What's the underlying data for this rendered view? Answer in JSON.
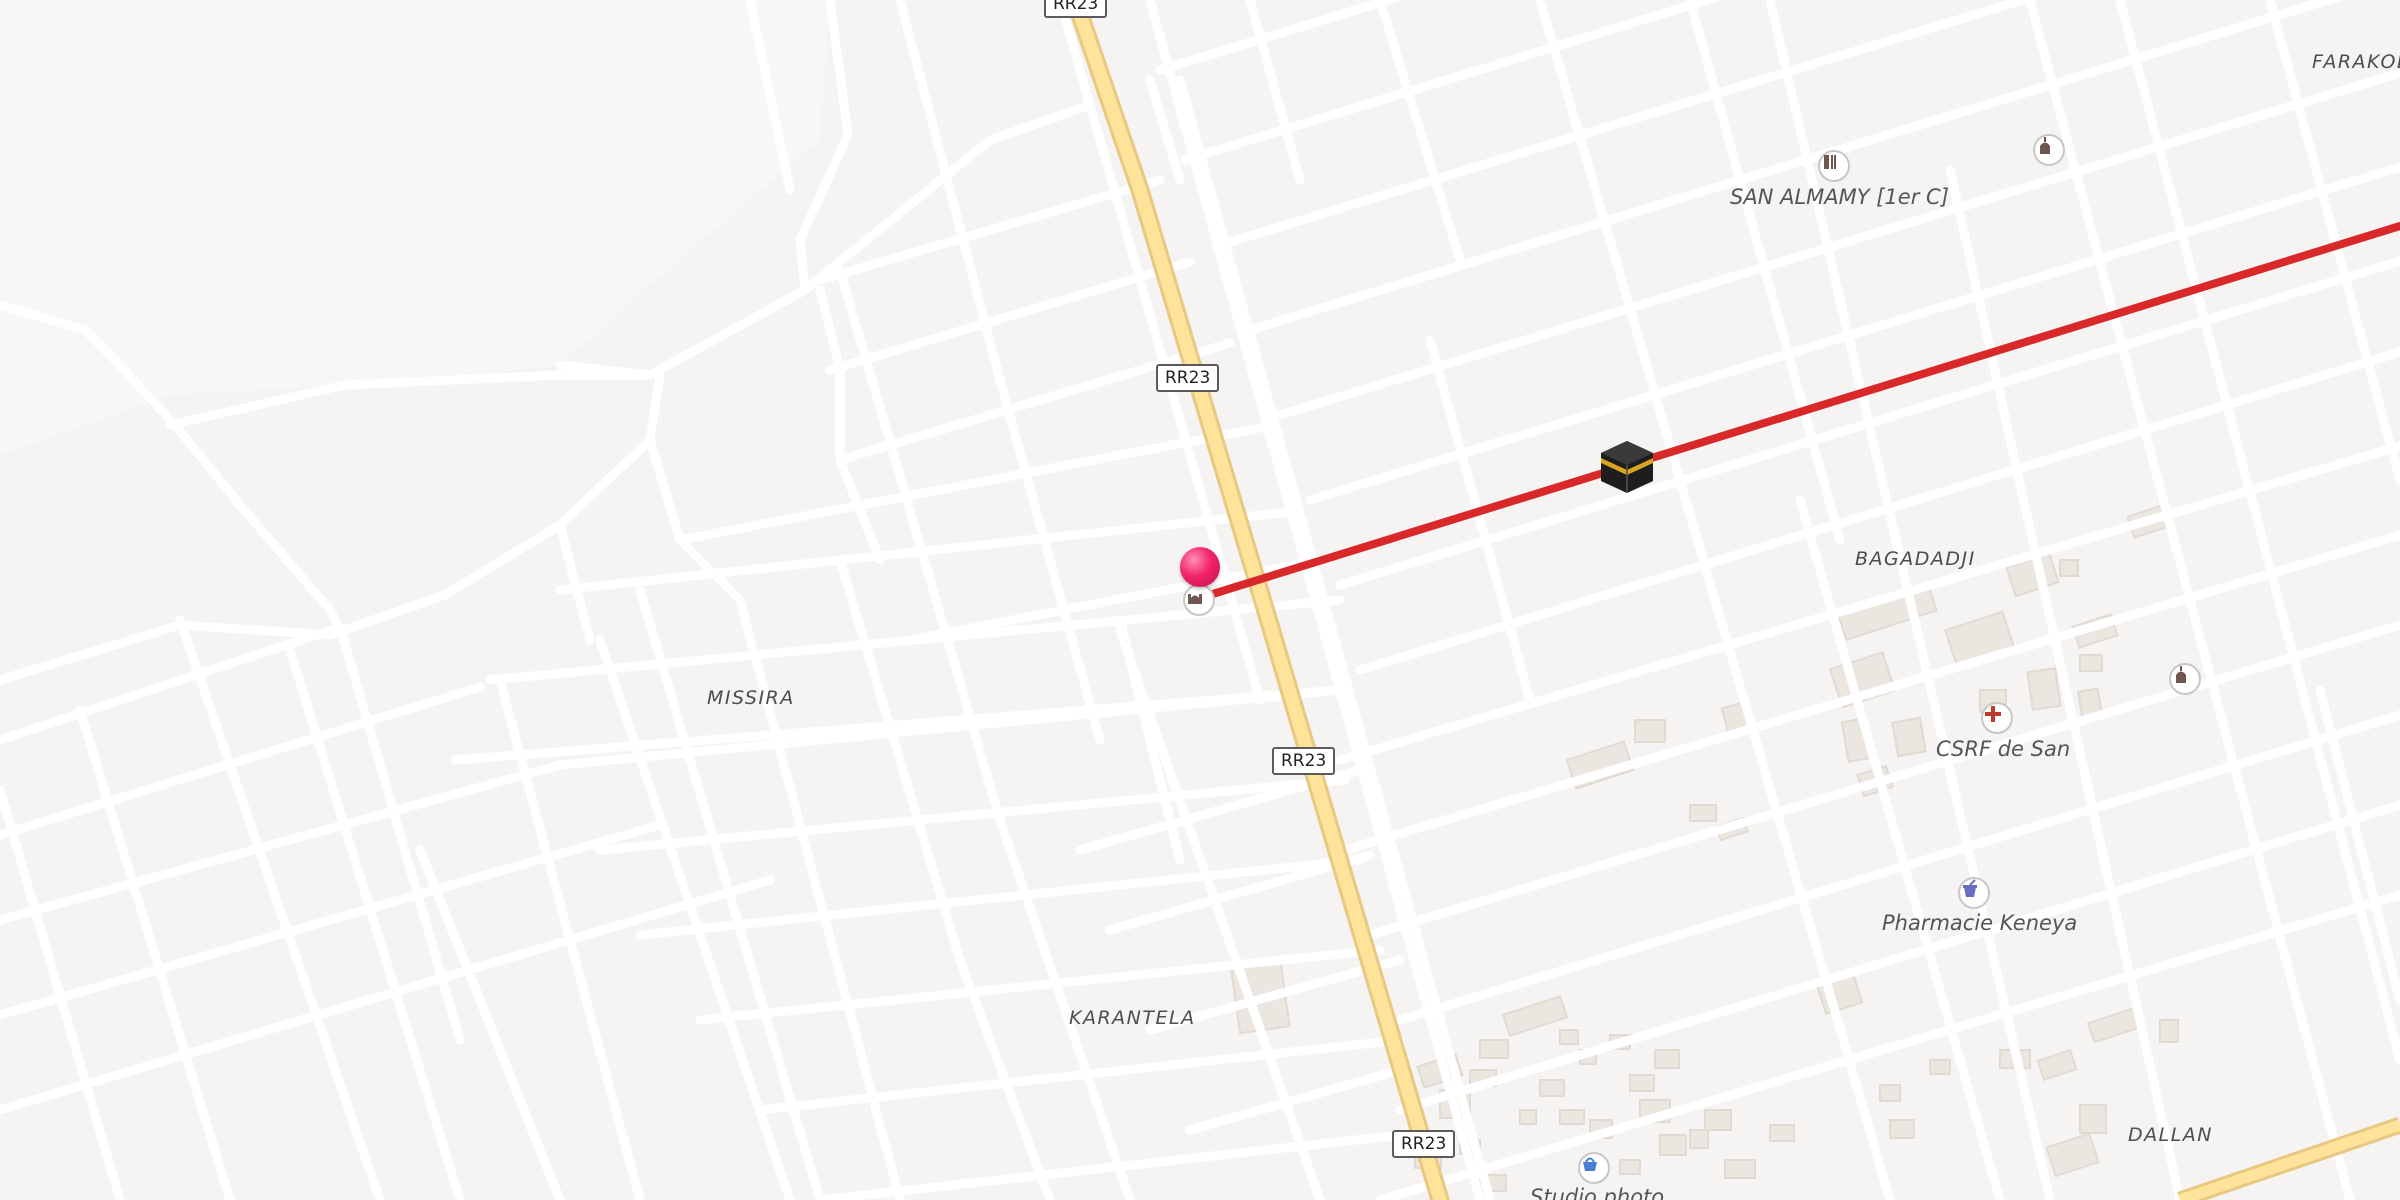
{
  "map": {
    "roads": [
      {
        "ref": "RR23"
      },
      {
        "ref": "RR23"
      },
      {
        "ref": "RR23"
      },
      {
        "ref": "RR23"
      }
    ],
    "districts": [
      {
        "name": "MISSIRA"
      },
      {
        "name": "KARANTELA"
      },
      {
        "name": "BAGADADJI"
      },
      {
        "name": "SAN ALMAMY [1er C]"
      },
      {
        "name": "DALLAN"
      },
      {
        "name": "FARAKOL"
      }
    ],
    "pois": [
      {
        "label": "CSRF de San",
        "icon": "hospital-icon"
      },
      {
        "label": "Pharmacie Keneya",
        "icon": "pharmacy-icon"
      },
      {
        "label": "Studio photo",
        "icon": "shop-basket-icon"
      },
      {
        "label": "",
        "icon": "mosque-icon"
      },
      {
        "label": "",
        "icon": "mosque-icon"
      },
      {
        "label": "",
        "icon": "mosque-icon"
      },
      {
        "label": "",
        "icon": "school-icon"
      }
    ],
    "route": {
      "color": "#d9282a",
      "destination_icon": "kaaba-icon"
    },
    "marker": {
      "color": "#f2226b",
      "icon": "map-pin-icon"
    },
    "colors": {
      "land": "#f6f4f2",
      "street": "#ffffff",
      "major_road": "#fde49a",
      "building": "#ebe6e0"
    }
  }
}
